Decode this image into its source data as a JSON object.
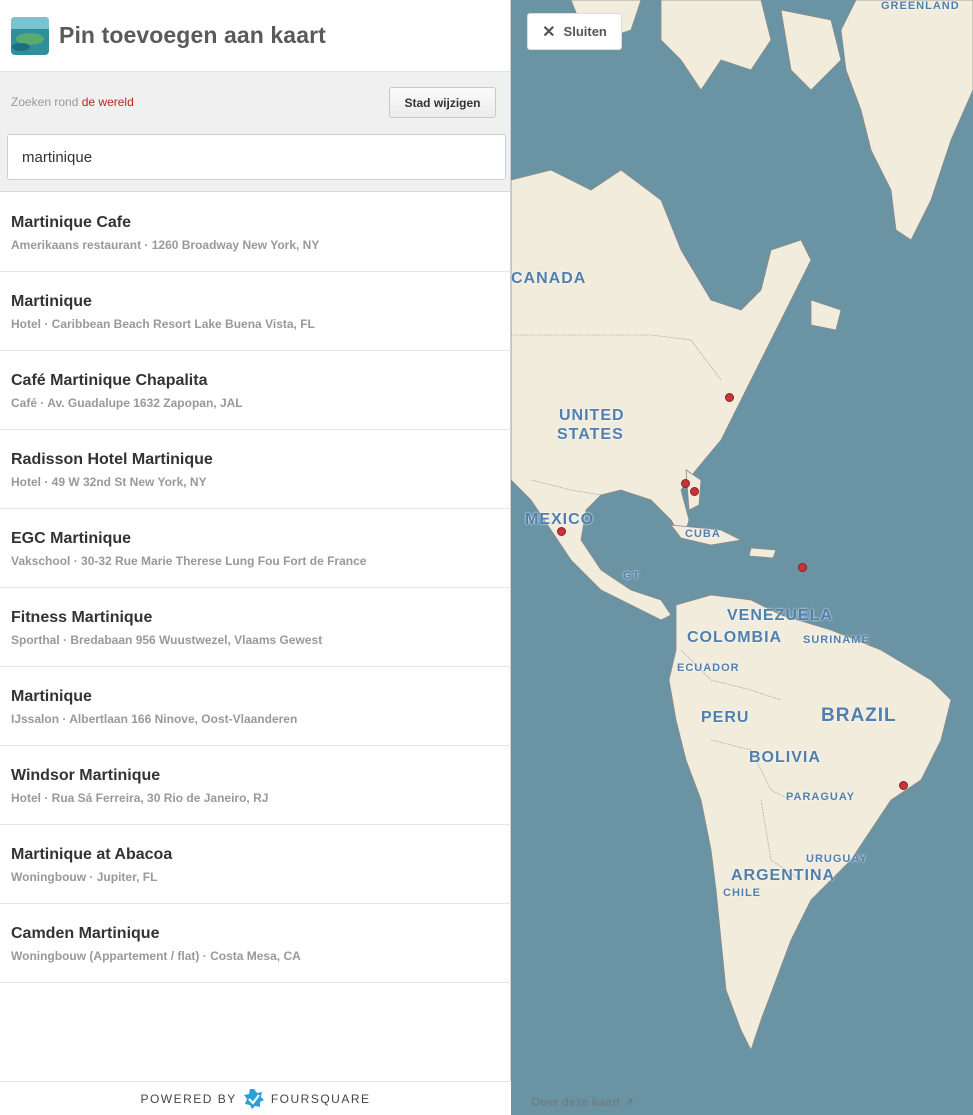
{
  "header": {
    "title": "Pin toevoegen aan kaart"
  },
  "search": {
    "near_prefix": "Zoeken rond",
    "near_value": "de wereld",
    "change_city_label": "Stad wijzigen",
    "query": "martinique"
  },
  "results": [
    {
      "name": "Martinique Cafe",
      "subtitle": "Amerikaans restaurant · 1260 Broadway New York, NY"
    },
    {
      "name": "Martinique",
      "subtitle": "Hotel · Caribbean Beach Resort Lake Buena Vista, FL"
    },
    {
      "name": "Café Martinique Chapalita",
      "subtitle": "Café · Av. Guadalupe 1632 Zapopan, JAL"
    },
    {
      "name": "Radisson Hotel Martinique",
      "subtitle": "Hotel · 49 W 32nd St New York, NY"
    },
    {
      "name": "EGC Martinique",
      "subtitle": "Vakschool · 30-32 Rue Marie Therese Lung Fou Fort de France"
    },
    {
      "name": "Fitness Martinique",
      "subtitle": "Sporthal · Bredabaan 956 Wuustwezel, Vlaams Gewest"
    },
    {
      "name": "Martinique",
      "subtitle": "IJssalon · Albertlaan 166 Ninove, Oost-Vlaanderen"
    },
    {
      "name": "Windsor Martinique",
      "subtitle": "Hotel · Rua Sá Ferreira, 30 Rio de Janeiro, RJ"
    },
    {
      "name": "Martinique at Abacoa",
      "subtitle": "Woningbouw · Jupiter, FL"
    },
    {
      "name": "Camden Martinique",
      "subtitle": "Woningbouw (Appartement / flat) · Costa Mesa, CA"
    }
  ],
  "footer": {
    "powered_by": "POWERED BY",
    "brand": "FOURSQUARE"
  },
  "map": {
    "close_label": "Sluiten",
    "about_label": "Over deze kaart",
    "labels": {
      "greenland": "GREENLAND",
      "canada": "CANADA",
      "united": "UNITED",
      "states": "STATES",
      "mexico": "MEXICO",
      "cuba": "CUBA",
      "gt": "GT",
      "venezuela": "VENEZUELA",
      "colombia": "COLOMBIA",
      "suriname": "SURINAME",
      "ecuador": "ECUADOR",
      "peru": "PERU",
      "brazil": "BRAZIL",
      "bolivia": "BOLIVIA",
      "paraguay": "PARAGUAY",
      "uruguay": "URUGUAY",
      "argentina": "ARGENTINA",
      "chile": "CHILE"
    }
  },
  "colors": {
    "ocean": "#6a94a3",
    "land": "#f1ecdc",
    "pin": "#c8343a",
    "link": "#b5281f",
    "label": "#4f7fae"
  }
}
